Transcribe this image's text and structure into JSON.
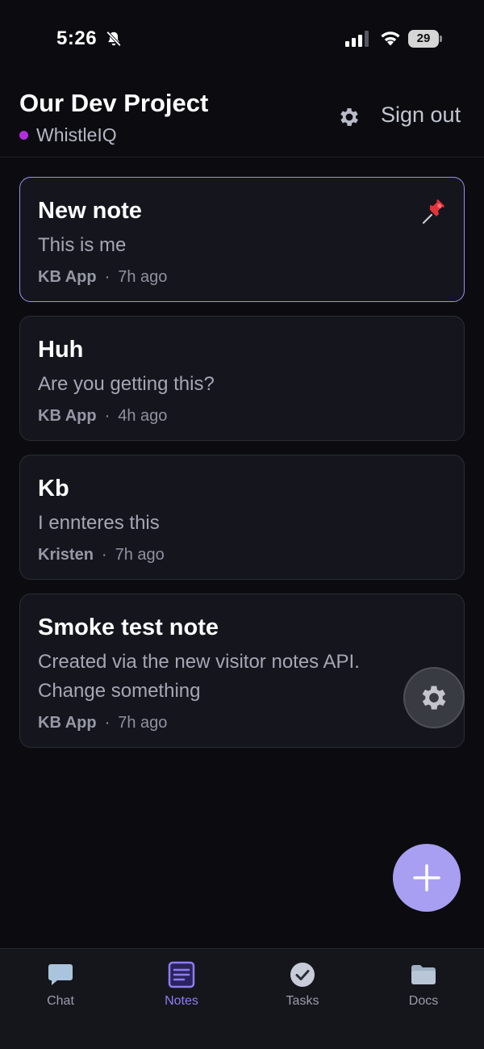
{
  "status_bar": {
    "time": "5:26",
    "battery": "29"
  },
  "header": {
    "title": "Our Dev Project",
    "org": "WhistleIQ",
    "signout_label": "Sign out"
  },
  "notes": [
    {
      "title": "New note",
      "body": "This is me",
      "author": "KB App",
      "time": "7h ago",
      "pinned": true
    },
    {
      "title": "Huh",
      "body": "Are you getting this?",
      "author": "KB App",
      "time": "4h ago"
    },
    {
      "title": "Kb",
      "body": "I ennteres this",
      "author": "Kristen",
      "time": "7h ago"
    },
    {
      "title": "Smoke test note",
      "body": "Created via the new visitor notes API. Change something",
      "author": "KB App",
      "time": "7h ago"
    }
  ],
  "tabs": [
    {
      "label": "Chat",
      "icon": "chat-bubble-icon"
    },
    {
      "label": "Notes",
      "icon": "notes-icon",
      "active": true
    },
    {
      "label": "Tasks",
      "icon": "check-circle-icon"
    },
    {
      "label": "Docs",
      "icon": "folder-icon"
    }
  ],
  "colors": {
    "accent": "#a89ff3",
    "org_dot": "#b12ee0",
    "background": "#0c0c10"
  },
  "meta_separator": "·"
}
